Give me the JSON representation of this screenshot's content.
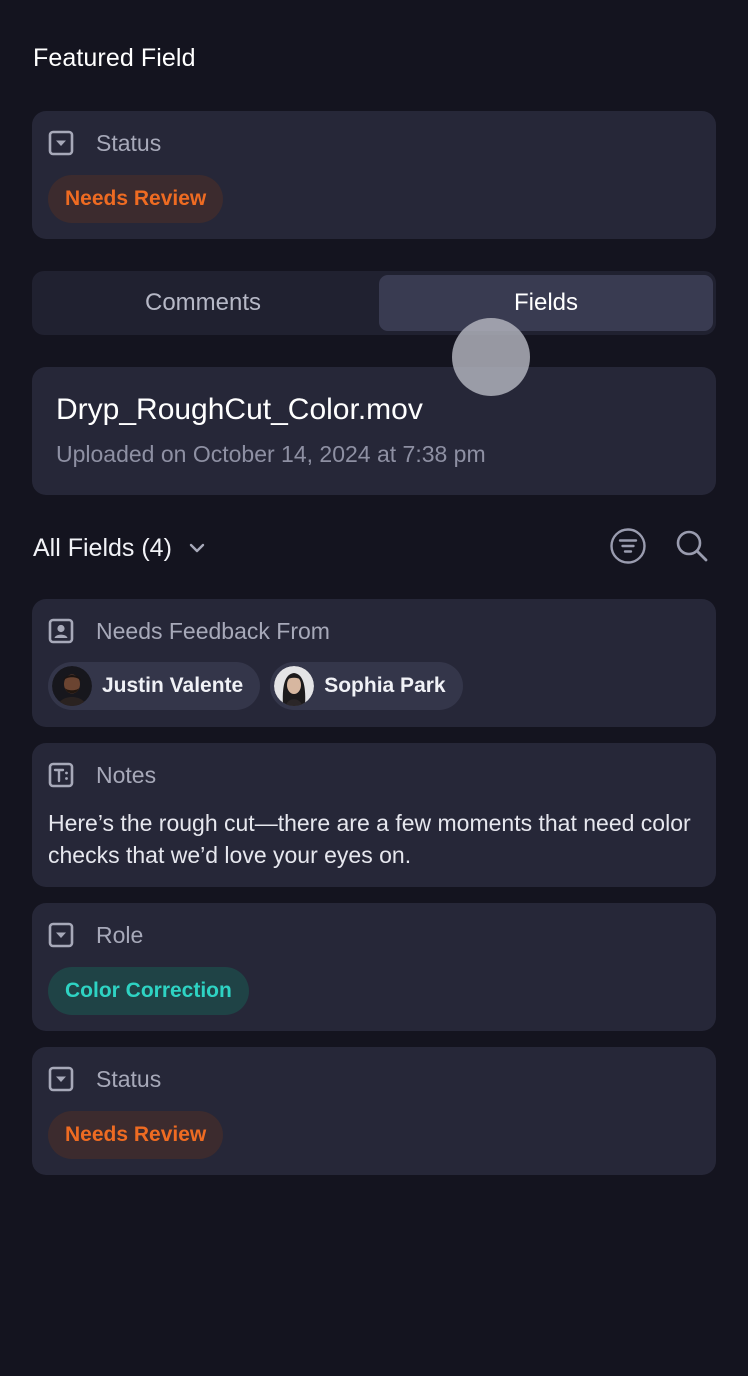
{
  "featured": {
    "title": "Featured Field",
    "field_label": "Status",
    "field_value": "Needs Review"
  },
  "tabs": {
    "comments": "Comments",
    "fields": "Fields",
    "active": "Fields"
  },
  "file": {
    "name": "Dryp_RoughCut_Color.mov",
    "uploaded": "Uploaded on October 14, 2024 at 7:38 pm"
  },
  "fields_header": {
    "label": "All Fields (4)"
  },
  "fields": {
    "feedback": {
      "label": "Needs Feedback From",
      "people": [
        "Justin Valente",
        "Sophia Park"
      ]
    },
    "notes": {
      "label": "Notes",
      "text": "Here’s the rough cut—there are a few moments that need color checks that we’d love your eyes on."
    },
    "role": {
      "label": "Role",
      "value": "Color Correction"
    },
    "status": {
      "label": "Status",
      "value": "Needs Review"
    }
  },
  "colors": {
    "background": "#14141f",
    "card": "#262738",
    "status_text": "#ee6b22",
    "role_text": "#2ed3c3"
  }
}
